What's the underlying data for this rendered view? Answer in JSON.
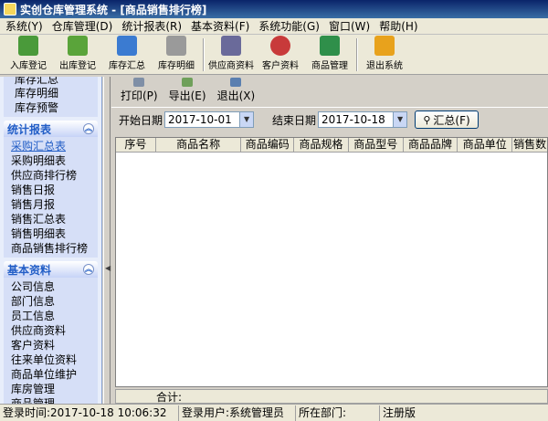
{
  "window": {
    "title": "实创仓库管理系统 - [商品销售排行榜]"
  },
  "menu": [
    "系统(Y)",
    "仓库管理(D)",
    "统计报表(R)",
    "基本资料(F)",
    "系统功能(G)",
    "窗口(W)",
    "帮助(H)"
  ],
  "toolbar": {
    "items": [
      {
        "label": "入库登记",
        "color": "#4a9a3a"
      },
      {
        "label": "出库登记",
        "color": "#5aa43a"
      },
      {
        "label": "库存汇总",
        "color": "#3b7bd1"
      },
      {
        "label": "库存明细",
        "color": "#9a9a9a"
      },
      {
        "label": "供应商资料",
        "color": "#6a6a9a"
      },
      {
        "label": "客户资料",
        "color": "#c83a3a"
      },
      {
        "label": "商品管理",
        "color": "#2f8f4a"
      },
      {
        "label": "退出系统",
        "color": "#e8a21c"
      }
    ]
  },
  "sidebar": {
    "top_items": [
      "库存汇总",
      "库存明细",
      "库存预警"
    ],
    "sections": [
      {
        "title": "统计报表",
        "items": [
          "采购汇总表",
          "采购明细表",
          "供应商排行榜",
          "销售日报",
          "销售月报",
          "销售汇总表",
          "销售明细表",
          "商品销售排行榜"
        ]
      },
      {
        "title": "基本资料",
        "items": [
          "公司信息",
          "部门信息",
          "员工信息",
          "供应商资料",
          "客户资料",
          "往来单位资料",
          "商品单位维护",
          "库房管理",
          "商品管理"
        ]
      }
    ]
  },
  "report_toolbar": {
    "print": "打印(P)",
    "export": "导出(E)",
    "exit": "退出(X)"
  },
  "filters": {
    "start_label": "开始日期",
    "start_value": "2017-10-01",
    "end_label": "结束日期",
    "end_value": "2017-10-18",
    "sum_button": "汇总(F)"
  },
  "grid": {
    "columns": [
      "序号",
      "商品名称",
      "商品编码",
      "商品规格",
      "商品型号",
      "商品品牌",
      "商品单位",
      "销售数"
    ],
    "footer_label": "合计:"
  },
  "status": {
    "login_time": "登录时间:2017-10-18 10:06:32",
    "login_user": "登录用户:系统管理员",
    "department": "所在部门:",
    "registered": "注册版"
  }
}
